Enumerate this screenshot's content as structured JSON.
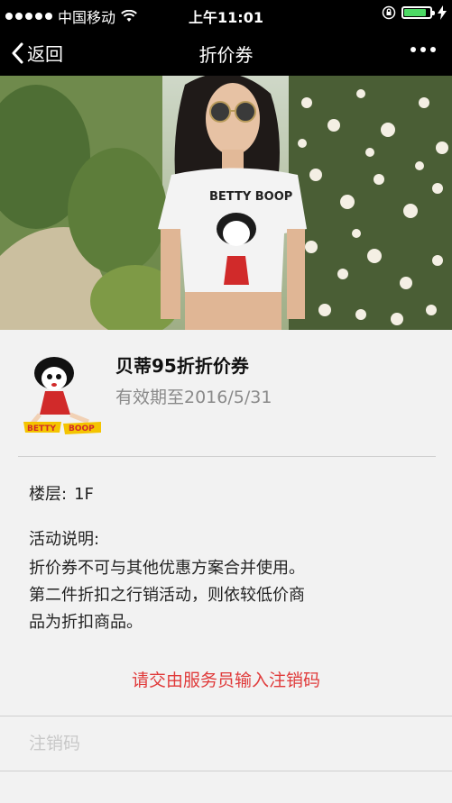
{
  "status": {
    "carrier": "中国移动",
    "time": "上午11:01"
  },
  "nav": {
    "back_label": "返回",
    "title": "折价券"
  },
  "hero": {
    "shirt_text": "BETTY BOOP"
  },
  "coupon": {
    "title": "贝蒂95折折价券",
    "expiry": "有效期至2016/5/31",
    "logo_text_left": "BETTY",
    "logo_text_right": "BOOP"
  },
  "details": {
    "floor_label": "楼层:",
    "floor_value": "1F",
    "desc_label": "活动说明:",
    "desc_line1": "折价券不可与其他优惠方案合并使用。",
    "desc_line2": "第二件折扣之行销活动，则依较低价商",
    "desc_line3": "品为折扣商品。"
  },
  "redeem": {
    "hint": "请交由服务员输入注销码",
    "placeholder": "注销码"
  },
  "colors": {
    "accent_red": "#e03a3a",
    "battery_green": "#4cd964",
    "bar_black": "#000000"
  }
}
